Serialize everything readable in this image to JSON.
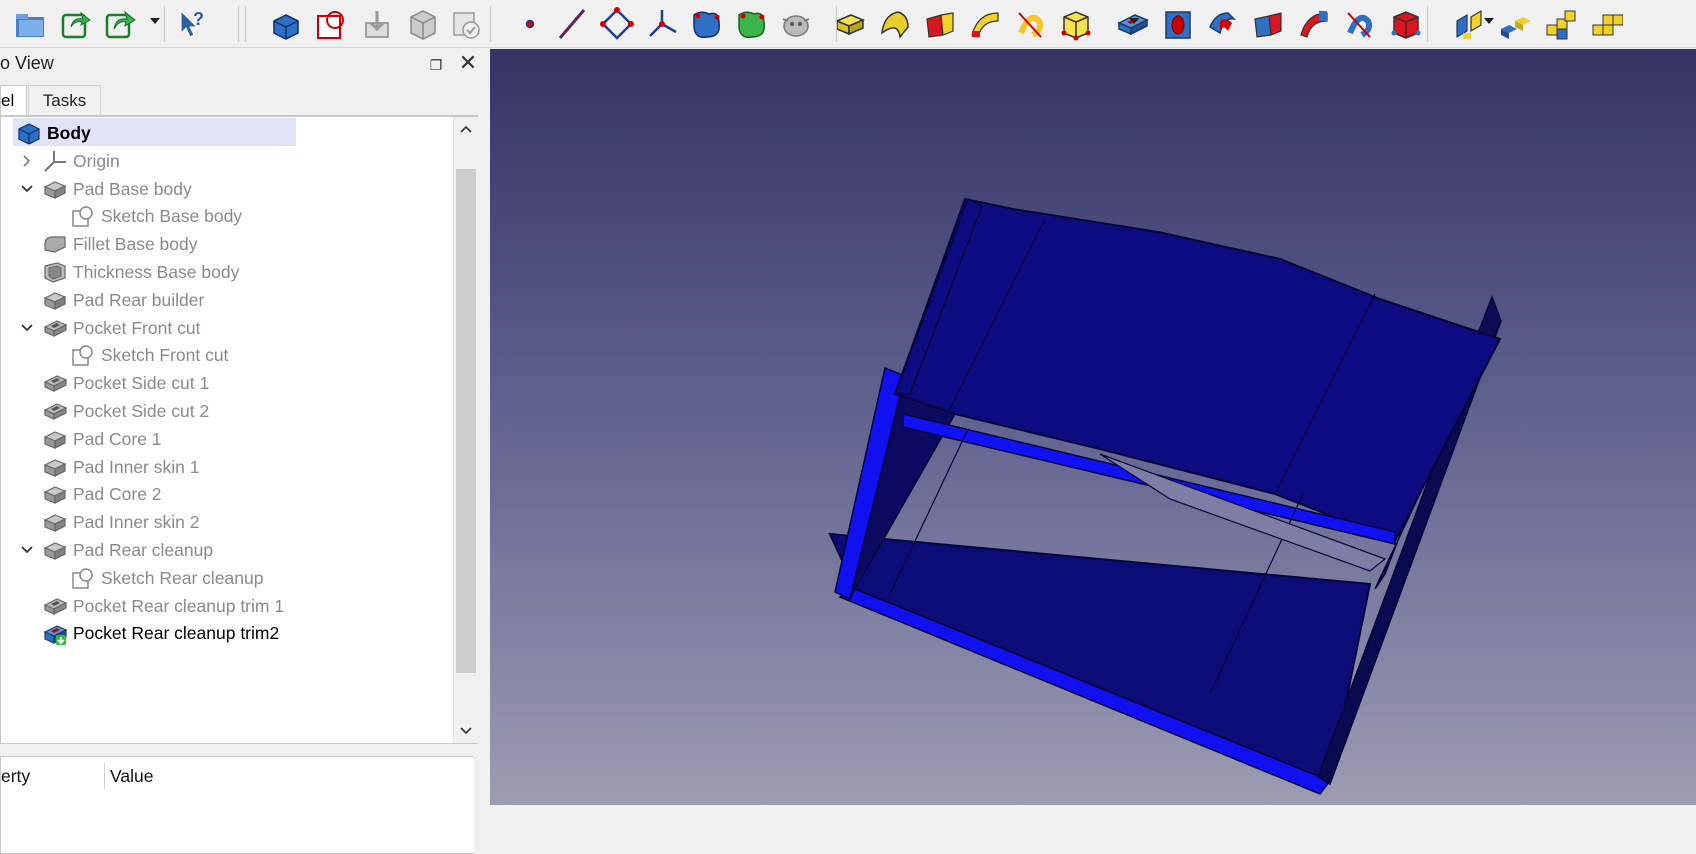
{
  "toolbar": {
    "buttons": [
      {
        "name": "open-icon",
        "tip": "Open"
      },
      {
        "name": "redo-icon",
        "tip": "Redo"
      },
      {
        "name": "redo-more-icon",
        "tip": "Redo"
      },
      {
        "name": "whats-this-icon",
        "tip": "What's This?"
      },
      {
        "name": "create-body-icon",
        "tip": "Body"
      },
      {
        "name": "create-sketch-icon",
        "tip": "Sketch"
      },
      {
        "name": "validate-sketch-icon",
        "tip": "Validate sketch"
      },
      {
        "name": "check-geometry-icon",
        "tip": "Check geometry"
      },
      {
        "name": "clone-icon",
        "tip": "Clone"
      },
      {
        "name": "datum-point-icon",
        "tip": "Datum point"
      },
      {
        "name": "datum-line-icon",
        "tip": "Datum line"
      },
      {
        "name": "datum-plane-icon",
        "tip": "Datum plane"
      },
      {
        "name": "local-cs-icon",
        "tip": "Local coordinate system"
      },
      {
        "name": "shape-binder-icon",
        "tip": "Shape binder"
      },
      {
        "name": "subshape-binder-icon",
        "tip": "SubShapeBinder"
      },
      {
        "name": "clone-sheep-icon",
        "tip": "Create a clone"
      },
      {
        "name": "pad-icon",
        "tip": "Pad"
      },
      {
        "name": "revolution-icon",
        "tip": "Revolution"
      },
      {
        "name": "additive-loft-icon",
        "tip": "Additive loft"
      },
      {
        "name": "additive-pipe-icon",
        "tip": "Additive pipe"
      },
      {
        "name": "additive-helix-icon",
        "tip": "Additive helix"
      },
      {
        "name": "additive-primitive-icon",
        "tip": "Additive primitive"
      },
      {
        "name": "pocket-icon",
        "tip": "Pocket"
      },
      {
        "name": "hole-icon",
        "tip": "Hole"
      },
      {
        "name": "groove-icon",
        "tip": "Groove"
      },
      {
        "name": "subtractive-loft-icon",
        "tip": "Subtractive loft"
      },
      {
        "name": "subtractive-pipe-icon",
        "tip": "Subtractive pipe"
      },
      {
        "name": "subtractive-helix-icon",
        "tip": "Subtractive helix"
      },
      {
        "name": "subtractive-primitive-icon",
        "tip": "Subtractive primitive"
      },
      {
        "name": "mirrored-icon",
        "tip": "Mirrored"
      },
      {
        "name": "linear-pattern-icon",
        "tip": "Linear pattern"
      },
      {
        "name": "polar-pattern-icon",
        "tip": "Polar pattern"
      },
      {
        "name": "multitransform-icon",
        "tip": "MultiTransform"
      }
    ]
  },
  "combo": {
    "title": "o View",
    "float_symbol": "❐",
    "close_symbol": "✕",
    "tabs": [
      {
        "label": "el"
      },
      {
        "label": "Tasks"
      }
    ]
  },
  "tree": {
    "items": [
      {
        "label": "Body",
        "icon": "body-icon",
        "indent": 0,
        "arrow": "none",
        "state": "selected"
      },
      {
        "label": "Origin",
        "icon": "origin-icon",
        "indent": 1,
        "arrow": "collapsed",
        "state": "dim"
      },
      {
        "label": "Pad Base body",
        "icon": "pad-feature-icon",
        "indent": 1,
        "arrow": "expanded",
        "state": "dim"
      },
      {
        "label": "Sketch Base body",
        "icon": "sketch-icon",
        "indent": 2,
        "arrow": "none",
        "state": "dim"
      },
      {
        "label": "Fillet Base body",
        "icon": "fillet-feature-icon",
        "indent": 1,
        "arrow": "none",
        "state": "dim"
      },
      {
        "label": "Thickness Base body",
        "icon": "thickness-feature-icon",
        "indent": 1,
        "arrow": "none",
        "state": "dim"
      },
      {
        "label": "Pad Rear builder",
        "icon": "pad-feature-icon",
        "indent": 1,
        "arrow": "none",
        "state": "dim"
      },
      {
        "label": "Pocket Front cut",
        "icon": "pocket-feature-icon",
        "indent": 1,
        "arrow": "expanded",
        "state": "dim"
      },
      {
        "label": "Sketch Front cut",
        "icon": "sketch-icon",
        "indent": 2,
        "arrow": "none",
        "state": "dim"
      },
      {
        "label": "Pocket Side cut 1",
        "icon": "pocket-feature-icon",
        "indent": 1,
        "arrow": "none",
        "state": "dim"
      },
      {
        "label": "Pocket Side cut 2",
        "icon": "pocket-feature-icon",
        "indent": 1,
        "arrow": "none",
        "state": "dim"
      },
      {
        "label": "Pad Core 1",
        "icon": "pad-feature-icon",
        "indent": 1,
        "arrow": "none",
        "state": "dim"
      },
      {
        "label": "Pad Inner skin 1",
        "icon": "pad-feature-icon",
        "indent": 1,
        "arrow": "none",
        "state": "dim"
      },
      {
        "label": "Pad Core 2",
        "icon": "pad-feature-icon",
        "indent": 1,
        "arrow": "none",
        "state": "dim"
      },
      {
        "label": "Pad Inner skin 2",
        "icon": "pad-feature-icon",
        "indent": 1,
        "arrow": "none",
        "state": "dim"
      },
      {
        "label": "Pad Rear cleanup",
        "icon": "pad-feature-icon",
        "indent": 1,
        "arrow": "expanded",
        "state": "dim"
      },
      {
        "label": "Sketch Rear cleanup",
        "icon": "sketch-icon",
        "indent": 2,
        "arrow": "none",
        "state": "dim"
      },
      {
        "label": "Pocket Rear cleanup trim 1",
        "icon": "pocket-feature-icon",
        "indent": 1,
        "arrow": "none",
        "state": "dim"
      },
      {
        "label": "Pocket Rear cleanup trim2",
        "icon": "tip-pocket-icon",
        "indent": 1,
        "arrow": "none",
        "state": "tip"
      }
    ]
  },
  "properties": {
    "col_property": "erty",
    "col_value": "Value"
  },
  "colors": {
    "model_face": "#0a0a7a",
    "model_edge": "#0000ff",
    "viewport_top": "#333366",
    "viewport_bottom": "#9c9cb3",
    "selection": "#e1e4f8"
  }
}
